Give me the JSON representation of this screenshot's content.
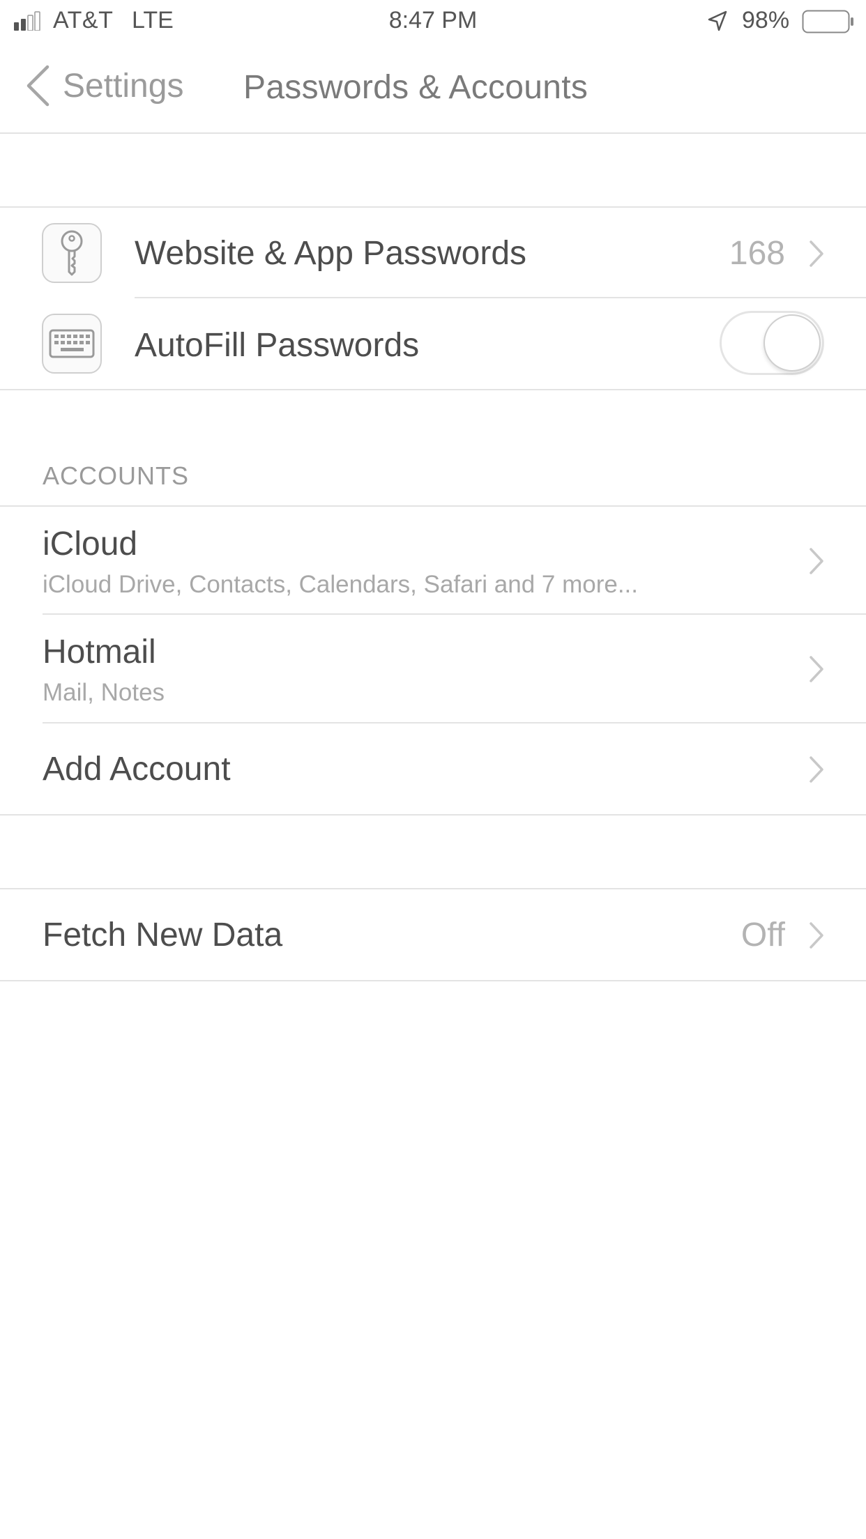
{
  "status_bar": {
    "carrier": "AT&T",
    "network": "LTE",
    "time": "8:47 PM",
    "battery_percent": "98%"
  },
  "nav": {
    "back_label": "Settings",
    "title": "Passwords & Accounts"
  },
  "passwords_group": {
    "website_passwords": {
      "label": "Website & App Passwords",
      "value": "168",
      "icon": "key-icon"
    },
    "autofill": {
      "label": "AutoFill Passwords",
      "icon": "keyboard-icon",
      "toggle_on": false
    }
  },
  "accounts_section": {
    "header": "ACCOUNTS",
    "items": [
      {
        "title": "iCloud",
        "subtitle": "iCloud Drive, Contacts, Calendars, Safari and 7 more..."
      },
      {
        "title": "Hotmail",
        "subtitle": "Mail, Notes"
      }
    ],
    "add_account_label": "Add Account"
  },
  "fetch_group": {
    "label": "Fetch New Data",
    "value": "Off"
  },
  "colors": {
    "separator": "#e3e3e3",
    "secondary_text": "#a8a8a8",
    "primary_text": "#4d4d4d"
  }
}
